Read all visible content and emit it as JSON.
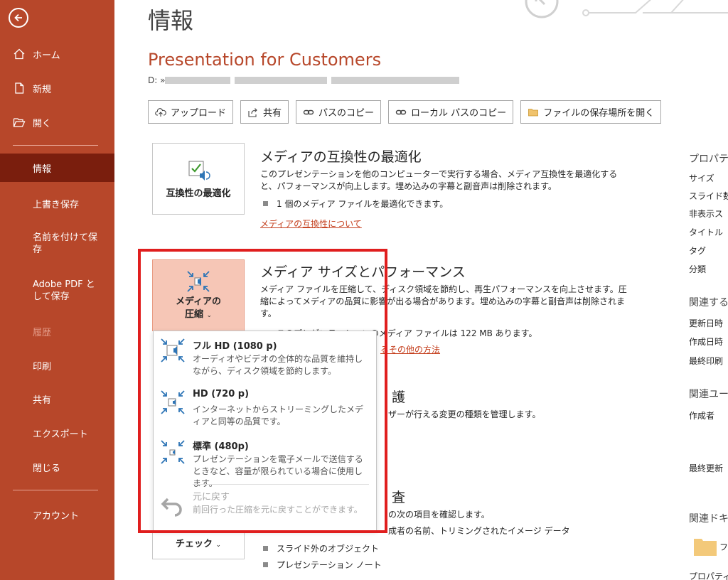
{
  "sidebar": {
    "items": [
      {
        "label": "ホーム"
      },
      {
        "label": "新規"
      },
      {
        "label": "開く"
      },
      {
        "label": "情報"
      },
      {
        "label": "上書き保存"
      },
      {
        "label": "名前を付けて保存"
      },
      {
        "label": "Adobe PDF として保存"
      },
      {
        "label": "履歴"
      },
      {
        "label": "印刷"
      },
      {
        "label": "共有"
      },
      {
        "label": "エクスポート"
      },
      {
        "label": "閉じる"
      },
      {
        "label": "アカウント"
      }
    ]
  },
  "header": {
    "title": "情報",
    "doc_title": "Presentation for Customers",
    "path_prefix": "D: »"
  },
  "toolbar": {
    "upload": "アップロード",
    "share": "共有",
    "copy_path": "パスのコピー",
    "copy_local_path": "ローカル パスのコピー",
    "open_location": "ファイルの保存場所を開く"
  },
  "compat": {
    "button": "互換性の最適化",
    "title": "メディアの互換性の最適化",
    "desc": "このプレゼンテーションを他のコンピューターで実行する場合、メディア互換性を最適化すると、パフォーマンスが向上します。埋め込みの字幕と副音声は削除されます。",
    "bullet": "1 個のメディア ファイルを最適化できます。",
    "link": "メディアの互換性について"
  },
  "media": {
    "button_line1": "メディアの",
    "button_line2": "圧縮",
    "title": "メディア サイズとパフォーマンス",
    "desc": "メディア ファイルを圧縮して、ディスク領域を節約し、再生パフォーマンスを向上させます。圧縮によってメディアの品質に影響が出る場合があります。埋め込みの字幕と副音声は削除されます。",
    "bullet": "このプレゼンテーションのメディア ファイルは 122 MB あります。",
    "link": "るその他の方法"
  },
  "protect": {
    "title_tail": "護",
    "desc_tail": "ザーが行える変更の種類を管理します。"
  },
  "inspect": {
    "title_tail": "査",
    "desc_tail": "の次の項目を確認します。",
    "line2_tail": "成者の名前、トリミングされたイメージ データ",
    "button": "チェック",
    "bullets": [
      "スライド外のオブジェクト",
      "プレゼンテーション ノート"
    ]
  },
  "dropdown": {
    "items": [
      {
        "title": "フル HD (1080 p)",
        "desc": "オーディオやビデオの全体的な品質を維持しながら、ディスク領域を節約します。"
      },
      {
        "title": "HD (720 p)",
        "desc": "インターネットからストリーミングしたメディアと同等の品質です。"
      },
      {
        "title": "標準 (480p)",
        "desc": "プレゼンテーションを電子メールで送信するときなど、容量が限られている場合に使用します。"
      },
      {
        "title": "元に戻す",
        "desc": "前回行った圧縮を元に戻すことができます。"
      }
    ]
  },
  "properties": {
    "head": "プロパティ",
    "rows": [
      "サイズ",
      "スライド数",
      "非表示ス",
      "タイトル",
      "タグ",
      "分類"
    ],
    "related_dates_head": "関連する",
    "date_rows": [
      "更新日時",
      "作成日時",
      "最終印刷"
    ],
    "related_users_head": "関連ユー",
    "author": "作成者",
    "last_modified_by": "最終更新",
    "related_docs_head": "関連ドキ",
    "folder_label": "フ",
    "all_props_link": "プロパティ"
  },
  "colors": {
    "sidebar": "#b7472a",
    "accent": "#c43e1c",
    "highlight_box": "#e01e1e"
  }
}
